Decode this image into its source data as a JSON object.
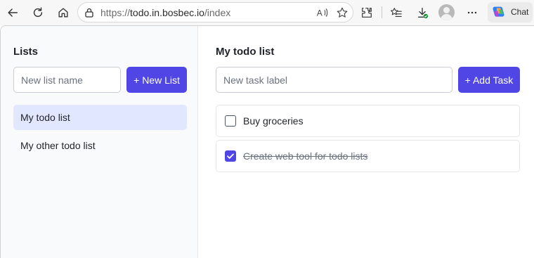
{
  "browser": {
    "url_prefix": "https://",
    "url_host": "todo.in.bosbec.io",
    "url_path": "/index",
    "chat_label": "Chat"
  },
  "sidebar": {
    "title": "Lists",
    "new_list_placeholder": "New list name",
    "new_list_button": "+ New List",
    "items": [
      {
        "label": "My todo list",
        "active": true
      },
      {
        "label": "My other todo list",
        "active": false
      }
    ]
  },
  "main": {
    "title": "My todo list",
    "new_task_placeholder": "New task label",
    "add_task_button": "+ Add Task",
    "tasks": [
      {
        "label": "Buy groceries",
        "done": false
      },
      {
        "label": "Create web tool for todo lists",
        "done": true
      }
    ]
  },
  "colors": {
    "accent": "#4f46e5",
    "active_item_bg": "#e0e7ff"
  }
}
